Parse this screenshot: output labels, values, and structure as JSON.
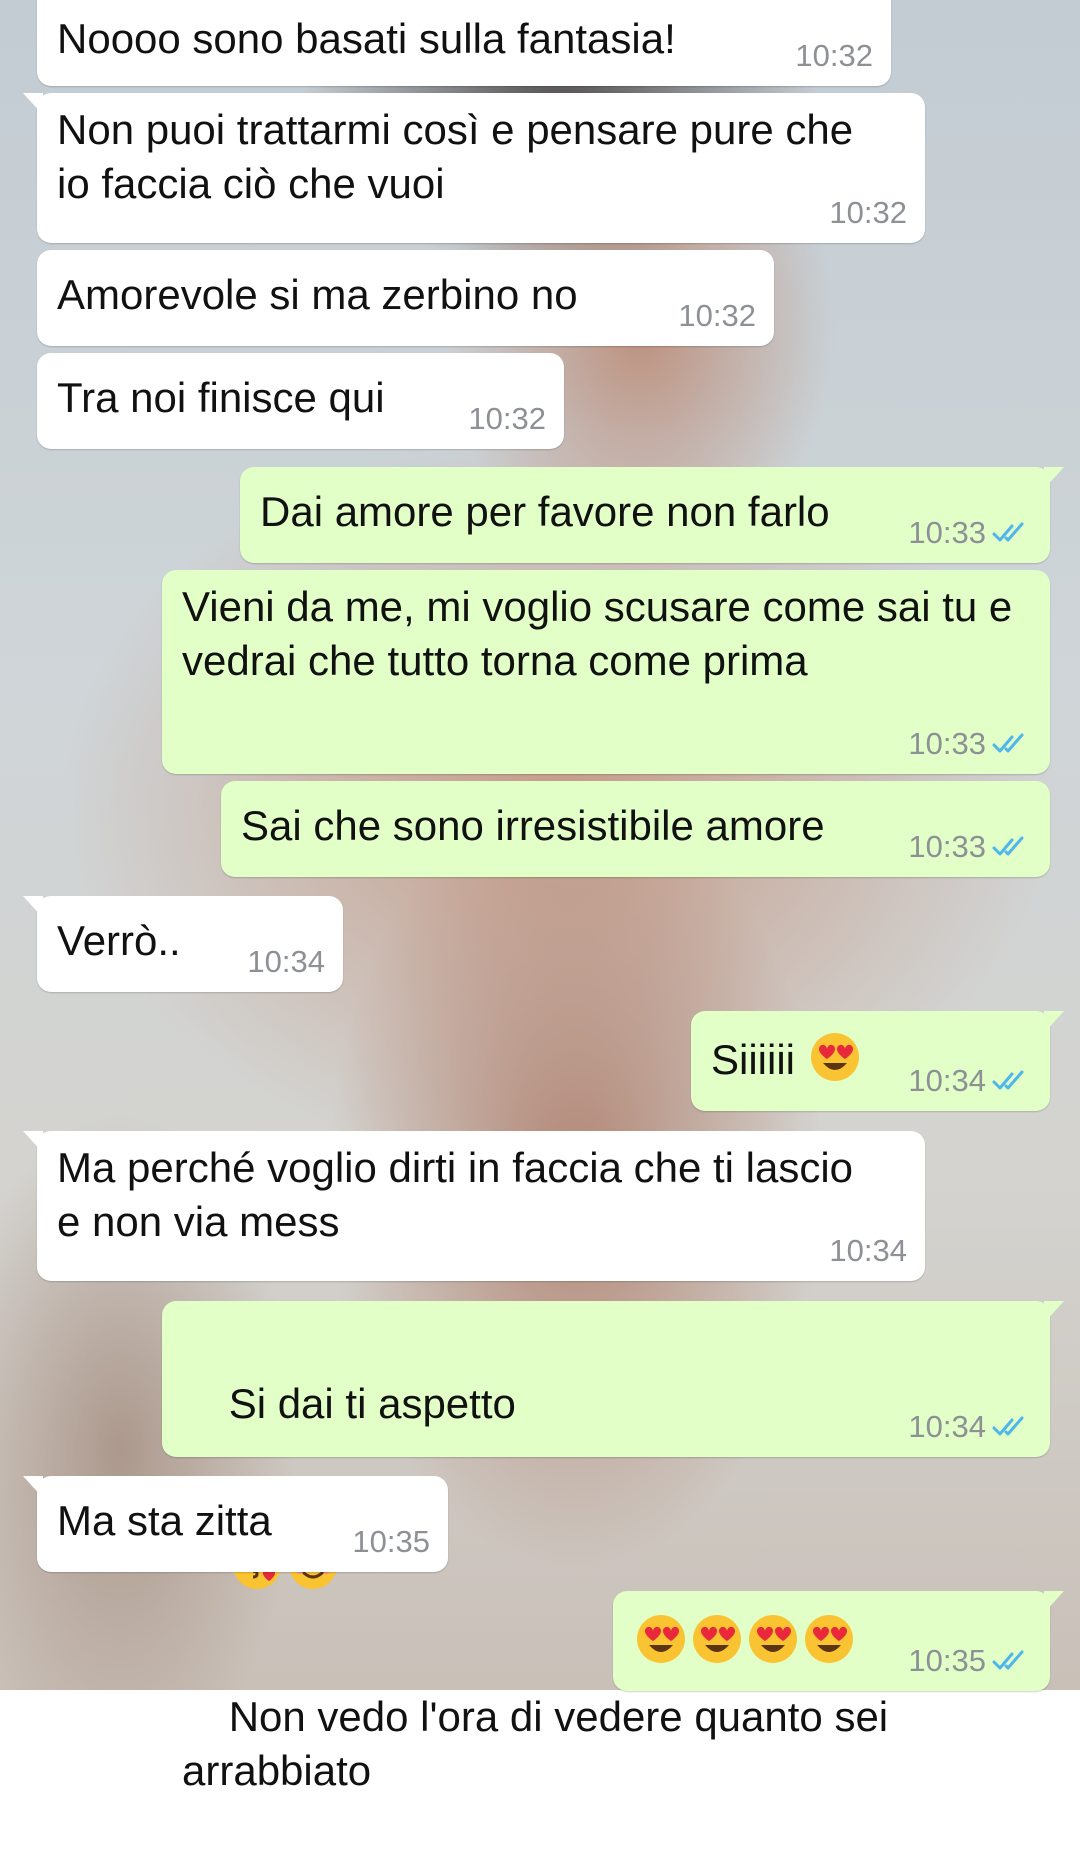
{
  "colors": {
    "incoming_bubble": "#ffffff",
    "outgoing_bubble": "#e1ffc7",
    "timestamp": "#8d9196",
    "read_ticks": "#4fb6ec"
  },
  "messages": [
    {
      "dir": "in",
      "text": "Noooo sono basati sulla fantasia!",
      "time": "10:32"
    },
    {
      "dir": "in",
      "text": "Non puoi trattarmi così e pensare pure che io faccia ciò che vuoi",
      "time": "10:32"
    },
    {
      "dir": "in",
      "text": "Amorevole si ma zerbino no",
      "time": "10:32"
    },
    {
      "dir": "in",
      "text": "Tra noi finisce qui",
      "time": "10:32"
    },
    {
      "dir": "out",
      "text": "Dai amore per favore non farlo",
      "time": "10:33",
      "status": "read"
    },
    {
      "dir": "out",
      "text": "Vieni da me, mi voglio scusare come sai tu e vedrai che tutto torna come prima",
      "time": "10:33",
      "status": "read"
    },
    {
      "dir": "out",
      "text": "Sai che sono irresistibile amore",
      "time": "10:33",
      "status": "read"
    },
    {
      "dir": "in",
      "text": "Verrò..",
      "time": "10:34"
    },
    {
      "dir": "out",
      "text": "Siiiiii",
      "emoji_after": [
        "heart-eyes-emoji"
      ],
      "time": "10:34",
      "status": "read"
    },
    {
      "dir": "in",
      "text": "Ma perché voglio dirti in faccia che ti lascio e non via mess",
      "time": "10:34"
    },
    {
      "dir": "out",
      "text_before": "Si dai ti aspetto",
      "emoji_mid": [
        "face-blowing-kiss-emoji",
        "smiling-face-emoji"
      ],
      "text_after": "Non vedo l'ora di vedere quanto sei arrabbiato",
      "time": "10:34",
      "status": "read"
    },
    {
      "dir": "in",
      "text": "Ma sta zitta",
      "time": "10:35"
    },
    {
      "dir": "out",
      "emoji_only": [
        "heart-eyes-emoji",
        "heart-eyes-emoji",
        "heart-eyes-emoji",
        "heart-eyes-emoji"
      ],
      "time": "10:35",
      "status": "read"
    }
  ]
}
